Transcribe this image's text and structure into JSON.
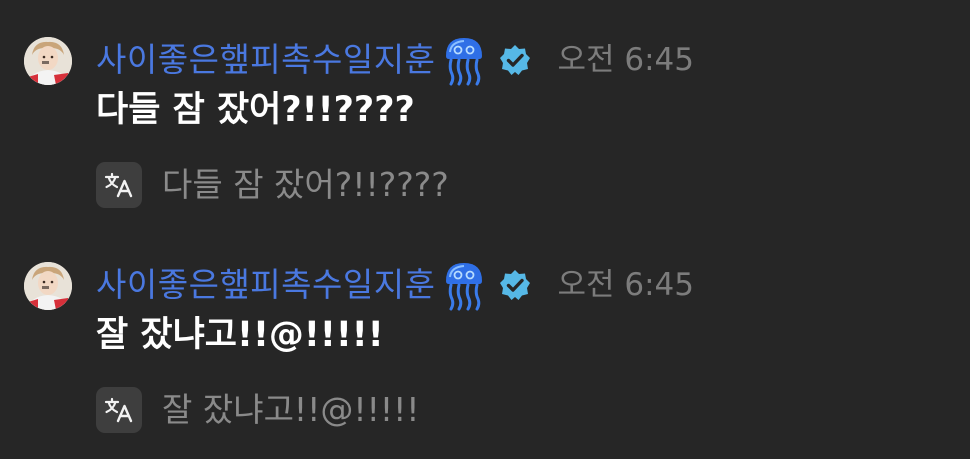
{
  "messages": [
    {
      "username": "사이좋은햎피촉수일지훈",
      "jelly_icon": "jellyfish-icon",
      "verified_icon": "verified-badge-icon",
      "timestamp": "오전 6:45",
      "content": "다들 잠 잤어?!!????",
      "translate_icon": "translate-icon",
      "translation": "다들 잠 잤어?!!????"
    },
    {
      "username": "사이좋은햎피촉수일지훈",
      "jelly_icon": "jellyfish-icon",
      "verified_icon": "verified-badge-icon",
      "timestamp": "오전 6:45",
      "content": "잘 잤냐고!!@!!!!!",
      "translate_icon": "translate-icon",
      "translation": "잘 잤냐고!!@!!!!!"
    }
  ],
  "colors": {
    "background": "#262626",
    "username": "#4a78e0",
    "timestamp": "#7c7c7c",
    "content": "#ffffff",
    "translation": "#8a8a8a",
    "verified": "#56b8e6"
  }
}
